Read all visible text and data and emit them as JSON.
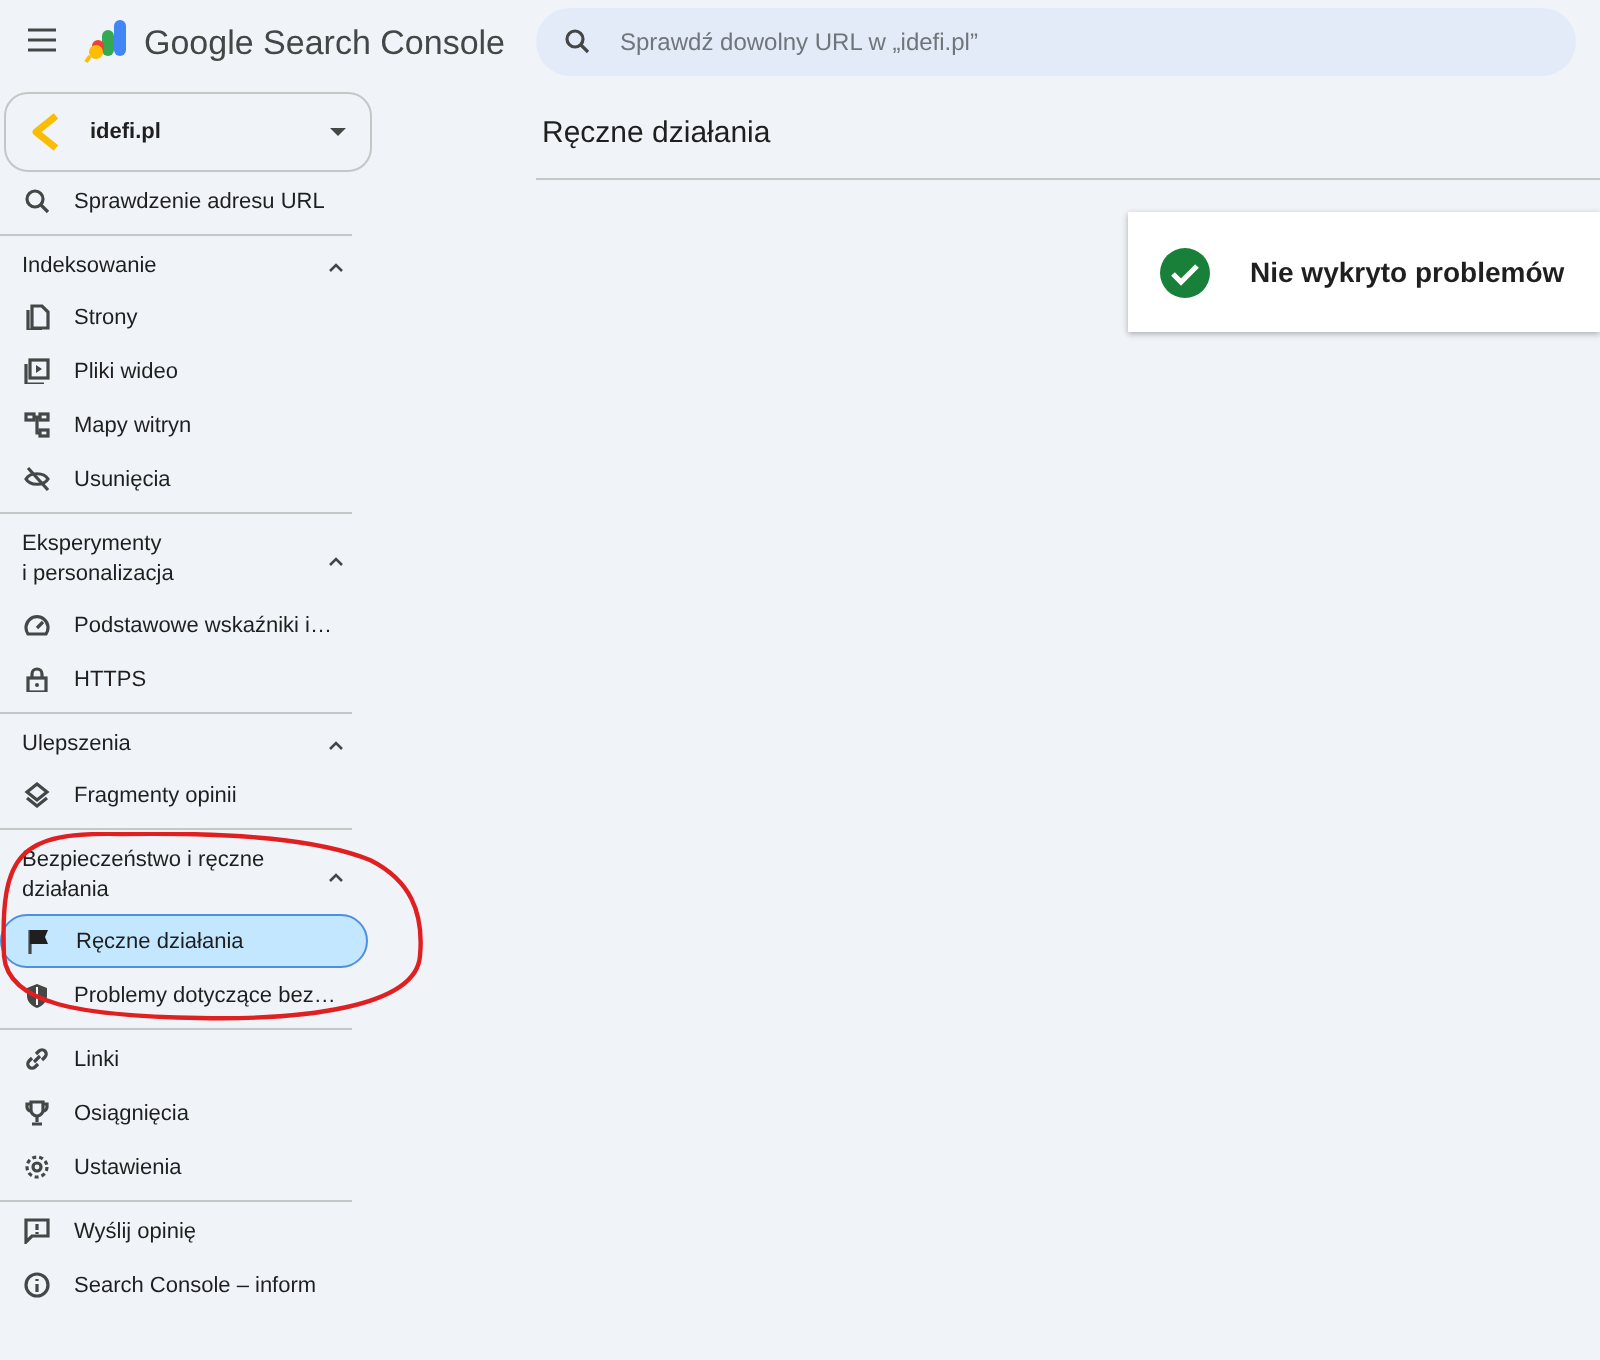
{
  "header": {
    "app_name": "Google Search Console",
    "search": {
      "placeholder": "Sprawdź dowolny URL w „idefi.pl”"
    }
  },
  "property": {
    "name": "idefi.pl"
  },
  "sidebar": {
    "sections": [
      {
        "items": [
          {
            "label": "Sprawdzenie adresu URL",
            "selected": false
          }
        ]
      },
      {
        "title": "Indeksowanie",
        "expanded": true,
        "items": [
          {
            "label": "Strony",
            "selected": false
          },
          {
            "label": "Pliki wideo",
            "selected": false
          },
          {
            "label": "Mapy witryn",
            "selected": false
          },
          {
            "label": "Usunięcia",
            "selected": false
          }
        ]
      },
      {
        "title": "Eksperymenty\ni personalizacja",
        "expanded": true,
        "items": [
          {
            "label": "Podstawowe wskaźniki i…",
            "selected": false
          },
          {
            "label": "HTTPS",
            "selected": false
          }
        ]
      },
      {
        "title": "Ulepszenia",
        "expanded": true,
        "items": [
          {
            "label": "Fragmenty opinii",
            "selected": false
          }
        ]
      },
      {
        "title": "Bezpieczeństwo i ręczne\ndziałania",
        "expanded": true,
        "items": [
          {
            "label": "Ręczne działania",
            "selected": true
          },
          {
            "label": "Problemy dotyczące bez…",
            "selected": false
          }
        ]
      },
      {
        "items": [
          {
            "label": "Linki",
            "selected": false
          },
          {
            "label": "Osiągnięcia",
            "selected": false
          },
          {
            "label": "Ustawienia",
            "selected": false
          }
        ]
      },
      {
        "items": [
          {
            "label": "Wyślij opinię",
            "selected": false
          },
          {
            "label": "Search Console – inform",
            "selected": false
          }
        ]
      }
    ]
  },
  "main": {
    "title": "Ręczne działania",
    "status_card": {
      "message": "Nie wykryto problemów"
    }
  }
}
